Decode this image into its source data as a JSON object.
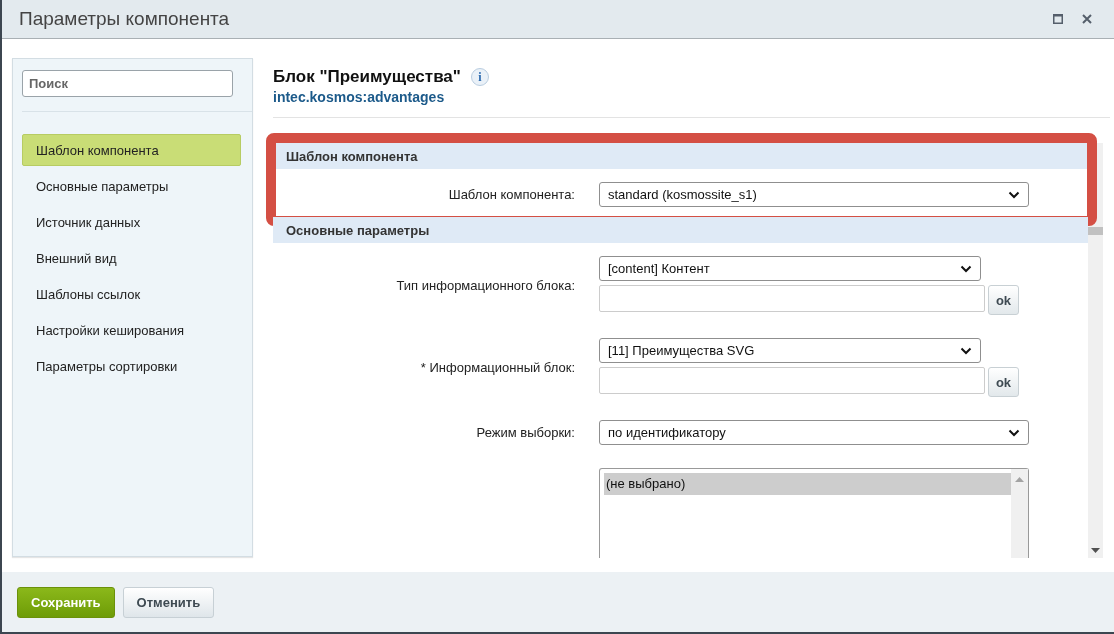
{
  "window": {
    "title": "Параметры компонента"
  },
  "sidebar": {
    "search_placeholder": "Поиск",
    "items": [
      {
        "label": "Шаблон компонента",
        "selected": true
      },
      {
        "label": "Основные параметры",
        "selected": false
      },
      {
        "label": "Источник данных",
        "selected": false
      },
      {
        "label": "Внешний вид",
        "selected": false
      },
      {
        "label": "Шаблоны ссылок",
        "selected": false
      },
      {
        "label": "Настройки кеширования",
        "selected": false
      },
      {
        "label": "Параметры сортировки",
        "selected": false
      }
    ]
  },
  "component": {
    "title": "Блок \"Преимущества\"",
    "code": "intec.kosmos:advantages",
    "info": "i"
  },
  "sections": [
    {
      "title": "Шаблон компонента",
      "highlighted": true,
      "fields": [
        {
          "kind": "select",
          "label": "Шаблон компонента:",
          "value": "standard (kosmossite_s1)"
        }
      ]
    },
    {
      "title": "Основные параметры",
      "highlighted": false,
      "fields": [
        {
          "kind": "select_filter",
          "label": "Тип информационного блока:",
          "value": "[content] Контент",
          "button": "ok"
        },
        {
          "kind": "select_filter",
          "label": "* Информационный блок:",
          "value": "[11] Преимущества SVG",
          "button": "ok"
        },
        {
          "kind": "select",
          "label": "Режим выборки:",
          "value": "по идентификатору"
        },
        {
          "kind": "listbox",
          "options": [
            {
              "label": "(не выбрано)",
              "selected": true
            }
          ]
        }
      ]
    }
  ],
  "buttons": [
    {
      "label": "Сохранить",
      "kind": "primary"
    },
    {
      "label": "Отменить",
      "kind": "secondary"
    }
  ]
}
